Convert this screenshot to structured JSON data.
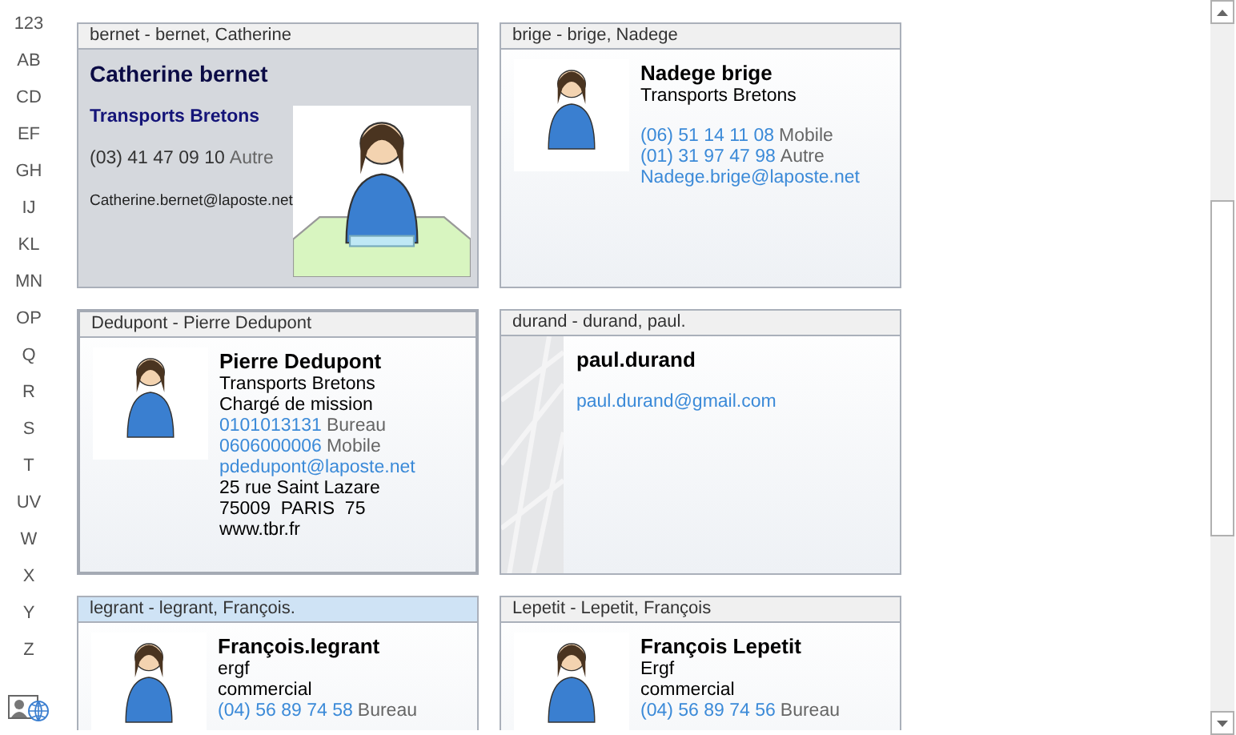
{
  "index": [
    "123",
    "AB",
    "CD",
    "EF",
    "GH",
    "IJ",
    "KL",
    "MN",
    "OP",
    "Q",
    "R",
    "S",
    "T",
    "UV",
    "W",
    "X",
    "Y",
    "Z"
  ],
  "cards": [
    {
      "header": "bernet - bernet, Catherine",
      "selected": true,
      "focused": false,
      "hovered": false,
      "kind": "photo-right",
      "groups": [
        [
          {
            "kind": "name",
            "text": "Catherine bernet"
          }
        ],
        [
          {
            "kind": "company",
            "text": "Transports Bretons"
          }
        ],
        [
          {
            "kind": "phone",
            "text": "(03) 41 47 09 10",
            "label": "Autre"
          }
        ],
        [
          {
            "kind": "email",
            "text": "Catherine.bernet@laposte.net"
          }
        ]
      ]
    },
    {
      "header": "brige - brige, Nadege",
      "selected": false,
      "focused": false,
      "hovered": false,
      "kind": "photo-left",
      "groups": [
        [
          {
            "kind": "name",
            "text": "Nadege brige"
          },
          {
            "kind": "company",
            "text": "Transports Bretons"
          }
        ],
        [
          {
            "kind": "phone",
            "text": "(06) 51 14 11 08",
            "label": "Mobile"
          },
          {
            "kind": "phone",
            "text": "(01) 31 97 47 98",
            "label": "Autre"
          },
          {
            "kind": "email",
            "text": "Nadege.brige@laposte.net"
          }
        ]
      ]
    },
    {
      "header": "Dedupont - Pierre Dedupont",
      "selected": false,
      "focused": true,
      "hovered": false,
      "kind": "photo-left",
      "groups": [
        [
          {
            "kind": "name",
            "text": "Pierre Dedupont"
          },
          {
            "kind": "company",
            "text": "Transports Bretons"
          },
          {
            "kind": "plain",
            "text": "Chargé de mission"
          },
          {
            "kind": "phone",
            "text": "0101013131",
            "label": "Bureau"
          },
          {
            "kind": "phone",
            "text": "0606000006",
            "label": "Mobile"
          },
          {
            "kind": "email",
            "text": "pdedupont@laposte.net"
          },
          {
            "kind": "plain",
            "text": "25 rue Saint Lazare"
          },
          {
            "kind": "plain",
            "text": "75009  PARIS  75"
          },
          {
            "kind": "plain",
            "text": "www.tbr.fr"
          }
        ]
      ]
    },
    {
      "header": "durand - durand, paul.",
      "selected": false,
      "focused": false,
      "hovered": false,
      "kind": "pattern",
      "groups": [
        [
          {
            "kind": "name",
            "text": "paul.durand"
          }
        ],
        [
          {
            "kind": "email",
            "text": "paul.durand@gmail.com"
          }
        ]
      ]
    },
    {
      "header": "legrant - legrant, François.",
      "selected": false,
      "focused": false,
      "hovered": true,
      "kind": "photo-left",
      "groups": [
        [
          {
            "kind": "name",
            "text": "François.legrant"
          },
          {
            "kind": "company",
            "text": "ergf"
          },
          {
            "kind": "plain",
            "text": "commercial"
          },
          {
            "kind": "phone",
            "text": "(04) 56 89 74 58",
            "label": "Bureau"
          }
        ]
      ]
    },
    {
      "header": "Lepetit - Lepetit, François",
      "selected": false,
      "focused": false,
      "hovered": false,
      "kind": "photo-left",
      "groups": [
        [
          {
            "kind": "name",
            "text": "François Lepetit"
          },
          {
            "kind": "company",
            "text": "Ergf"
          },
          {
            "kind": "plain",
            "text": "commercial"
          },
          {
            "kind": "phone",
            "text": "(04) 56 89 74 56",
            "label": "Bureau"
          }
        ]
      ]
    }
  ]
}
